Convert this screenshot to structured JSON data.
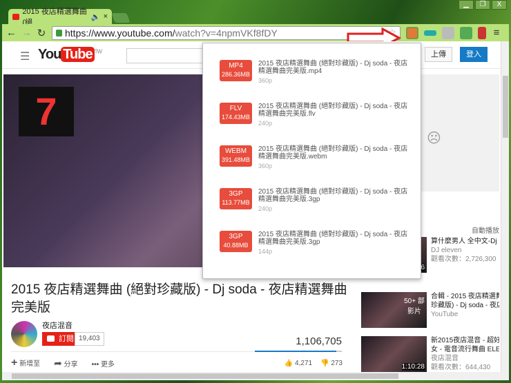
{
  "browser": {
    "tab_title": "2015 夜店精選舞曲 (絕",
    "url_host": "https://www.youtube.com/",
    "url_path": "watch?v=4npmVKf8fDY",
    "window_buttons": [
      "▁",
      "❐",
      "X"
    ]
  },
  "youtube": {
    "logo_you": "You",
    "logo_tube": "Tube",
    "region": "TW",
    "upload": "上傳",
    "signin": "登入",
    "title": "2015 夜店精選舞曲 (絕對珍藏版) - Dj soda - 夜店精選舞曲完美版",
    "channel": "夜店混音",
    "subscribe": "訂閱",
    "subscribers": "19,403",
    "views": "1,106,705",
    "actions": {
      "add": "新增至",
      "share": "分享",
      "more": "更多",
      "likes": "4,271",
      "dislikes": "273"
    },
    "like_ratio": 0.94,
    "autoplay": "自動播放",
    "recommended": [
      {
        "title": "算什麼男人 全中文-Dj",
        "channel": "DJ eleven",
        "views": "觀看次數：2,726,300",
        "duration": "6"
      },
      {
        "title": "合輯 - 2015 夜店精選舞",
        "title2": "珍藏版) - Dj soda - 夜店",
        "channel": "YouTube",
        "badge": "50+ 部影片"
      },
      {
        "title": "新2015夜店混音 - 超好",
        "title2": "女 - 電音流行舞曲 ELE",
        "channel": "夜店混音",
        "views": "觀看次數：644,430",
        "duration": "1:10:28"
      }
    ]
  },
  "downloads": [
    {
      "format": "MP4",
      "size": "286.36MB",
      "name": "2015 夜店精選舞曲 (絕對珍藏版) - Dj soda - 夜店精選舞曲完美版.mp4",
      "quality": "360p"
    },
    {
      "format": "FLV",
      "size": "174.43MB",
      "name": "2015 夜店精選舞曲 (絕對珍藏版) - Dj soda - 夜店精選舞曲完美版.flv",
      "quality": "240p"
    },
    {
      "format": "WEBM",
      "size": "391.48MB",
      "name": "2015 夜店精選舞曲 (絕對珍藏版) - Dj soda - 夜店精選舞曲完美版.webm",
      "quality": "360p"
    },
    {
      "format": "3GP",
      "size": "113.77MB",
      "name": "2015 夜店精選舞曲 (絕對珍藏版) - Dj soda - 夜店精選舞曲完美版.3gp",
      "quality": "240p"
    },
    {
      "format": "3GP",
      "size": "40.88MB",
      "name": "2015 夜店精選舞曲 (絕對珍藏版) - Dj soda - 夜店精選舞曲完美版.3gp",
      "quality": "144p"
    }
  ],
  "colors": {
    "badge": "#e74c3c",
    "youtube_red": "#e62117",
    "signin": "#167ac6"
  }
}
